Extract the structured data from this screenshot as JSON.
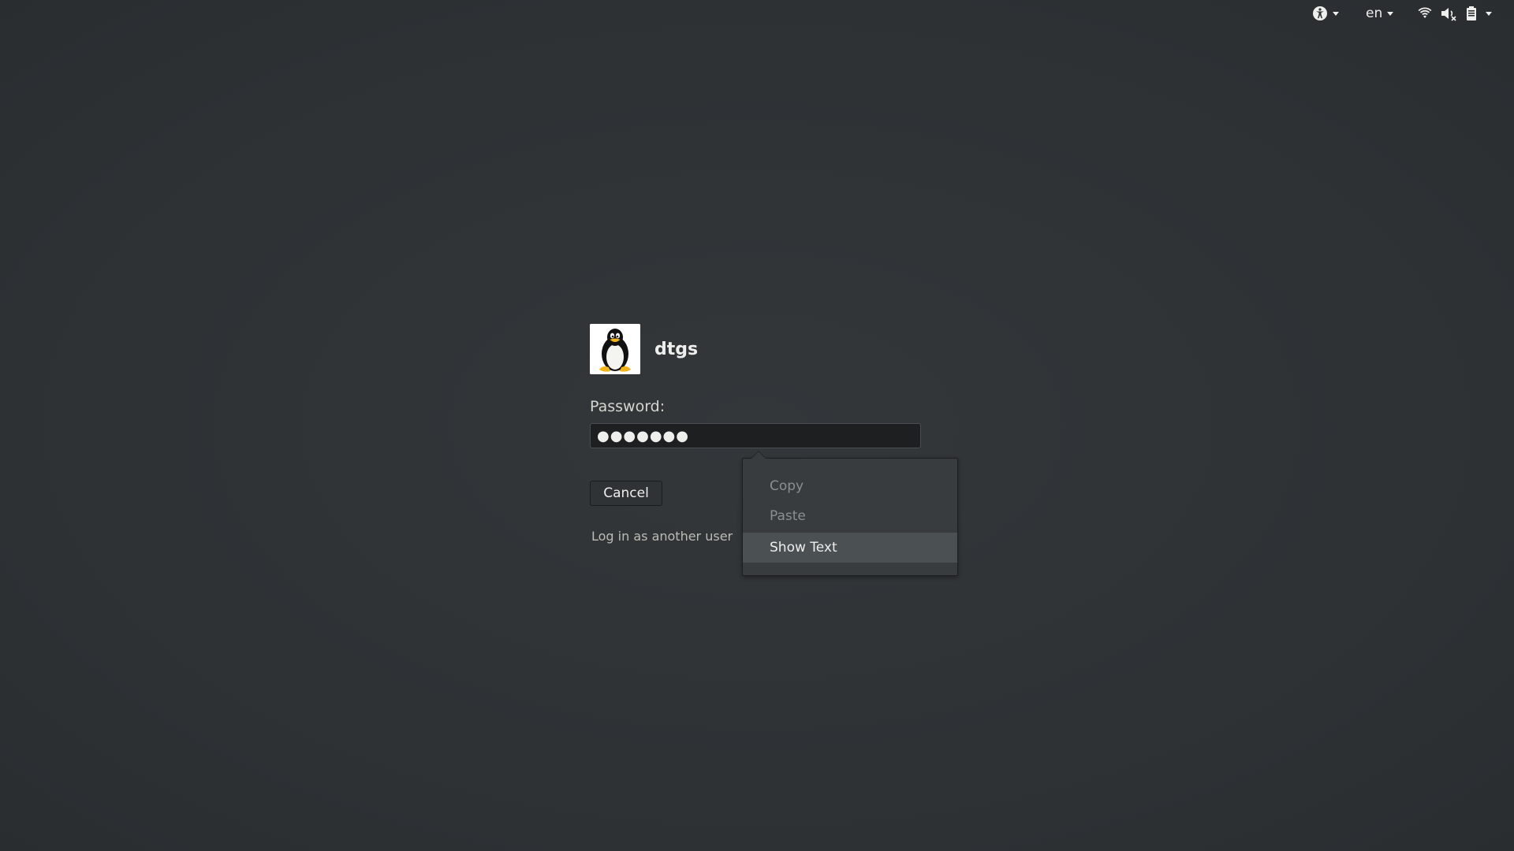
{
  "topbar": {
    "accessibility_icon": "accessibility-icon",
    "language": "en",
    "network_icon": "wifi-icon",
    "volume_icon": "volume-muted-icon",
    "battery_icon": "battery-icon"
  },
  "login": {
    "username": "dtgs",
    "avatar_icon": "tux-penguin-avatar",
    "password_label": "Password:",
    "password_value": "●●●●●●●",
    "cancel_label": "Cancel",
    "other_user_label": "Log in as another user"
  },
  "context_menu": {
    "items": [
      {
        "label": "Copy",
        "state": "disabled"
      },
      {
        "label": "Paste",
        "state": "disabled"
      },
      {
        "label": "Show Text",
        "state": "hover"
      }
    ]
  },
  "colors": {
    "background": "#2e3235",
    "menu_background": "#383c3f",
    "menu_hover": "#4b5053",
    "entry_background": "#1d1f21"
  }
}
